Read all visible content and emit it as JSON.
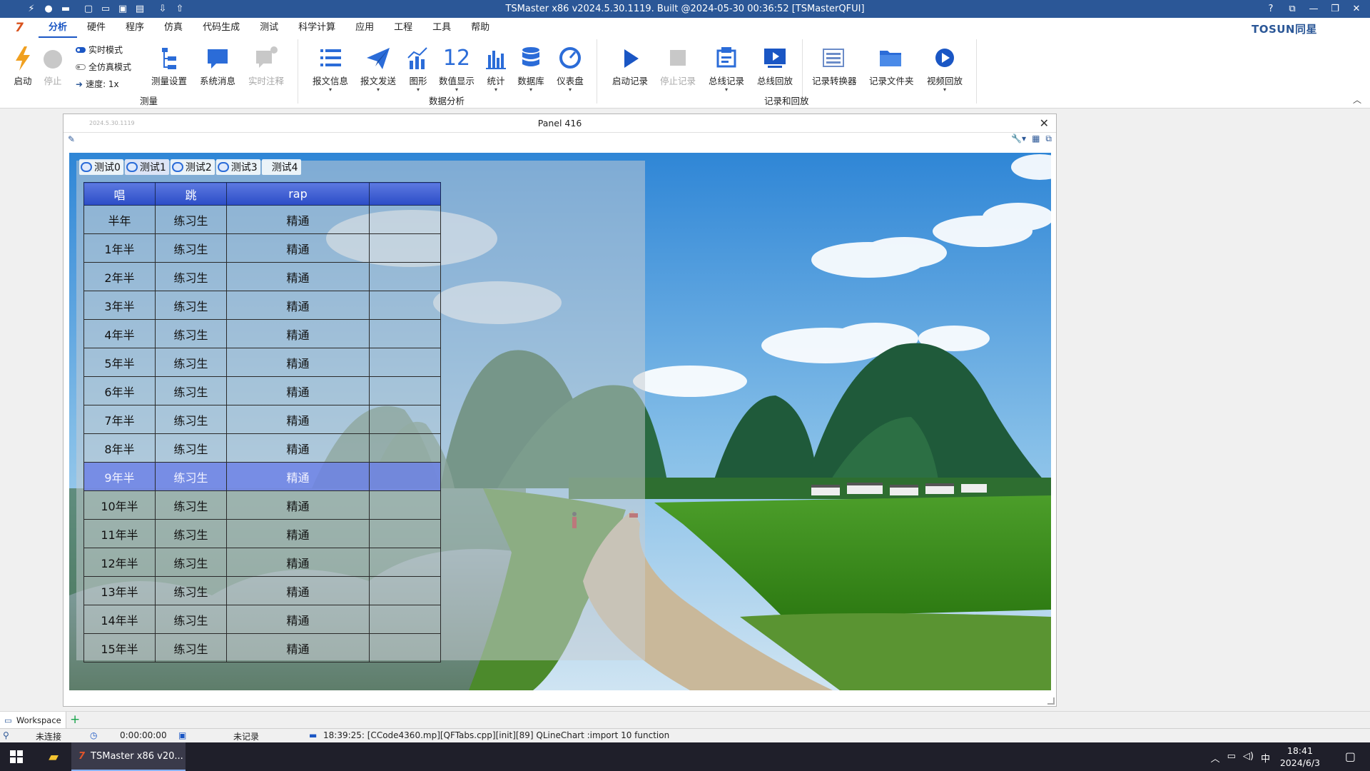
{
  "titlebar": {
    "title": "TSMaster x86 v2024.5.30.1119. Built @2024-05-30 00:36:52 [TSMasterQFUI]",
    "help": "?",
    "minimize": "—",
    "restore": "❐",
    "close": "✕"
  },
  "menubar": {
    "items": [
      "分析",
      "硬件",
      "程序",
      "仿真",
      "代码生成",
      "测试",
      "科学计算",
      "应用",
      "工程",
      "工具",
      "帮助"
    ],
    "active": "分析",
    "brand": "TOSUN同星"
  },
  "ribbon": {
    "measure": {
      "start": "启动",
      "stop": "停止",
      "realtime_mode": "实时模式",
      "sim_mode": "全仿真模式",
      "speed": "速度: 1x",
      "settings": "测量设置",
      "sys_msg": "系统消息",
      "realtime_note": "实时注释",
      "group": "测量"
    },
    "analysis": {
      "msg_info": "报文信息",
      "msg_send": "报文发送",
      "graph": "图形",
      "num_display": "数值显示",
      "num_icon": "12",
      "stats": "统计",
      "database": "数据库",
      "dashboard": "仪表盘",
      "group": "数据分析"
    },
    "record": {
      "start_rec": "启动记录",
      "stop_rec": "停止记录",
      "bus_rec": "总线记录",
      "bus_replay": "总线回放",
      "rec_converter": "记录转换器",
      "rec_folder": "记录文件夹",
      "video_replay": "视频回放",
      "group": "记录和回放"
    }
  },
  "panel": {
    "title": "Panel 416",
    "tiny_label": "2024.5.30.1119",
    "tabs": [
      "测试0",
      "测试1",
      "测试2",
      "测试3",
      "测试4"
    ],
    "active_tab": 1,
    "headers": [
      "唱",
      "跳",
      "rap",
      ""
    ],
    "rows": [
      [
        "半年",
        "练习生",
        "精通",
        ""
      ],
      [
        "1年半",
        "练习生",
        "精通",
        ""
      ],
      [
        "2年半",
        "练习生",
        "精通",
        ""
      ],
      [
        "3年半",
        "练习生",
        "精通",
        ""
      ],
      [
        "4年半",
        "练习生",
        "精通",
        ""
      ],
      [
        "5年半",
        "练习生",
        "精通",
        ""
      ],
      [
        "6年半",
        "练习生",
        "精通",
        ""
      ],
      [
        "7年半",
        "练习生",
        "精通",
        ""
      ],
      [
        "8年半",
        "练习生",
        "精通",
        ""
      ],
      [
        "9年半",
        "练习生",
        "精通",
        ""
      ],
      [
        "10年半",
        "练习生",
        "精通",
        ""
      ],
      [
        "11年半",
        "练习生",
        "精通",
        ""
      ],
      [
        "12年半",
        "练习生",
        "精通",
        ""
      ],
      [
        "13年半",
        "练习生",
        "精通",
        ""
      ],
      [
        "14年半",
        "练习生",
        "精通",
        ""
      ],
      [
        "15年半",
        "练习生",
        "精通",
        ""
      ]
    ],
    "selected_row": 9
  },
  "workspace": {
    "tab": "Workspace",
    "add": "+"
  },
  "statusbar": {
    "connection": "未连接",
    "time": "0:00:00:00",
    "record": "未记录",
    "log": "18:39:25: [CCode4360.mp][QFTabs.cpp][init][89] QLineChart :import 10 function"
  },
  "taskbar": {
    "app": "TSMaster x86 v20...",
    "ime": "中",
    "time": "18:41",
    "date": "2024/6/3"
  },
  "colors": {
    "titlebar": "#2b5797",
    "accent": "#1a56c4",
    "header_blue": "#3a5ad0",
    "selected_row": "#6e82e6"
  }
}
